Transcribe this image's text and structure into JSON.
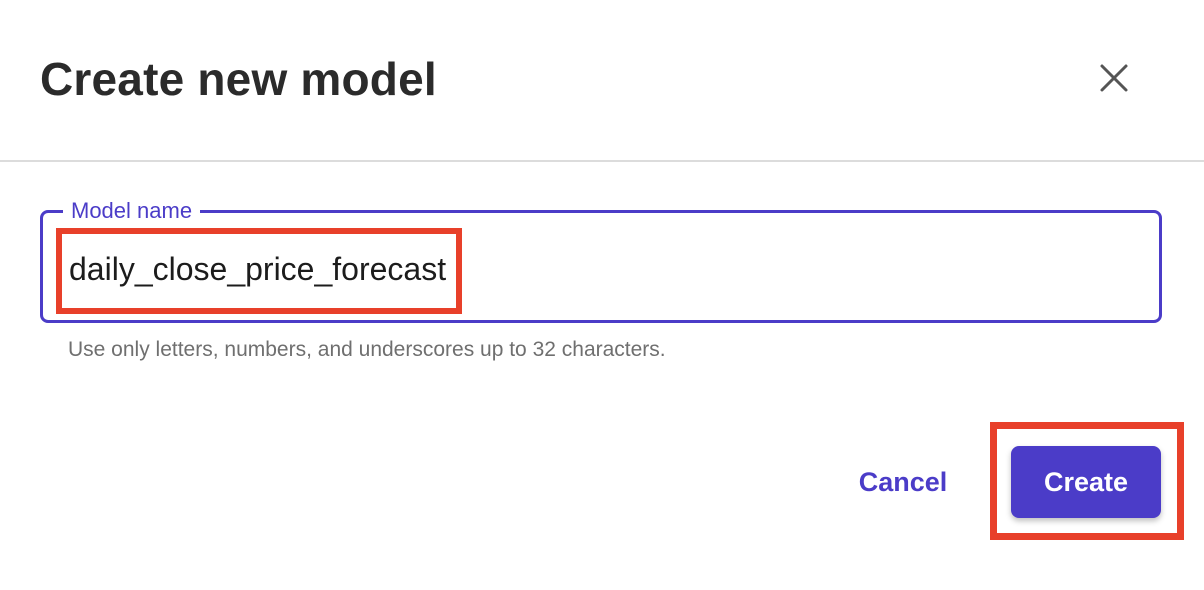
{
  "dialog": {
    "title": "Create new model"
  },
  "field": {
    "label": "Model name",
    "value": "daily_close_price_forecast",
    "helper": "Use only letters, numbers, and underscores up to 32 characters."
  },
  "actions": {
    "cancel_label": "Cancel",
    "create_label": "Create"
  },
  "icons": {
    "close": "close-icon"
  },
  "colors": {
    "accent": "#4b3cc8",
    "highlight": "#e8402a",
    "title": "#2b2b2b",
    "helper": "#6f6f6f"
  }
}
